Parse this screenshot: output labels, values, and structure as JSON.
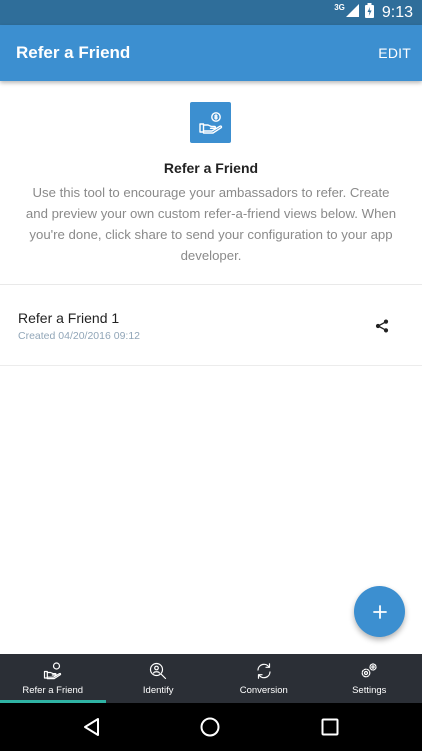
{
  "status_bar": {
    "network": "3G",
    "time": "9:13"
  },
  "app_bar": {
    "title": "Refer a Friend",
    "edit_label": "EDIT"
  },
  "intro": {
    "icon": "refer-hand-coin-icon",
    "title": "Refer a Friend",
    "description": "Use this tool to encourage your ambassadors to refer. Create and preview your own custom refer-a-friend views below. When you're done, click share to send your configuration to your app developer."
  },
  "items": [
    {
      "title": "Refer a Friend 1",
      "subtitle": "Created 04/20/2016 09:12",
      "action_icon": "share-icon"
    }
  ],
  "fab": {
    "icon": "plus-icon"
  },
  "bottom_nav": {
    "active": "Refer a Friend",
    "tabs": [
      {
        "label": "Refer a Friend",
        "icon": "refer-hand-icon"
      },
      {
        "label": "Identify",
        "icon": "magnifier-icon"
      },
      {
        "label": "Conversion",
        "icon": "refresh-icon"
      },
      {
        "label": "Settings",
        "icon": "gears-icon"
      }
    ]
  },
  "system_nav": {
    "buttons": [
      "back-icon",
      "home-icon",
      "recents-icon"
    ]
  },
  "colors": {
    "primary": "#3c8fd0",
    "status_bar": "#2f6e9a",
    "nav_bg": "#2b2f36",
    "active_indicator": "#2fb3a4"
  }
}
